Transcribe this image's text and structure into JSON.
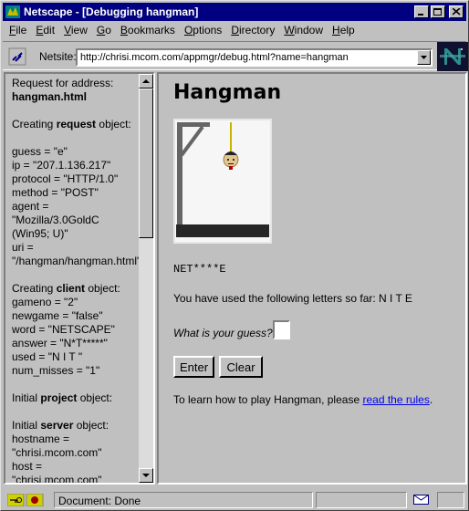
{
  "window": {
    "title": "Netscape - [Debugging hangman]"
  },
  "menu": [
    "File",
    "Edit",
    "View",
    "Go",
    "Bookmarks",
    "Options",
    "Directory",
    "Window",
    "Help"
  ],
  "location": {
    "label": "Netsite:",
    "url": "http://chrisi.mcom.com/appmgr/debug.html?name=hangman"
  },
  "left_frame": {
    "request_for_address_label": "Request for address:",
    "address": "hangman.html",
    "creating_request": [
      "Creating ",
      "request",
      " object:"
    ],
    "request_lines": [
      "guess = \"e\"",
      "ip = \"207.1.136.217\"",
      "protocol = \"HTTP/1.0\"",
      "method = \"POST\"",
      "agent = \"Mozilla/3.0GoldC (Win95; U)\"",
      "uri = \"/hangman/hangman.html\""
    ],
    "creating_client": [
      "Creating ",
      "client",
      " object:"
    ],
    "client_lines": [
      "gameno = \"2\"",
      "newgame = \"false\"",
      "word = \"NETSCAPE\"",
      "answer = \"N*T*****\"",
      "used = \"N I T \"",
      "num_misses = \"1\""
    ],
    "initial_project": [
      "Initial ",
      "project",
      " object:"
    ],
    "initial_server": [
      "Initial ",
      "server",
      " object:"
    ],
    "server_lines": [
      "hostname = \"chrisi.mcom.com\"",
      "host = \"chrisi.mcom.com\""
    ]
  },
  "right_frame": {
    "title": "Hangman",
    "word": "NET****E",
    "used_letters_text": "You have used the following letters so far: N I T E",
    "guess_label": "What is your guess?",
    "guess_value": "",
    "enter_label": "Enter",
    "clear_label": "Clear",
    "rules_prefix": "To learn how to play Hangman, please ",
    "rules_link": "read the rules",
    "rules_suffix": "."
  },
  "status": {
    "text": "Document: Done"
  },
  "colors": {
    "titlebar": "#000080",
    "link": "#0000ee",
    "chrome": "#c0c0c0"
  }
}
